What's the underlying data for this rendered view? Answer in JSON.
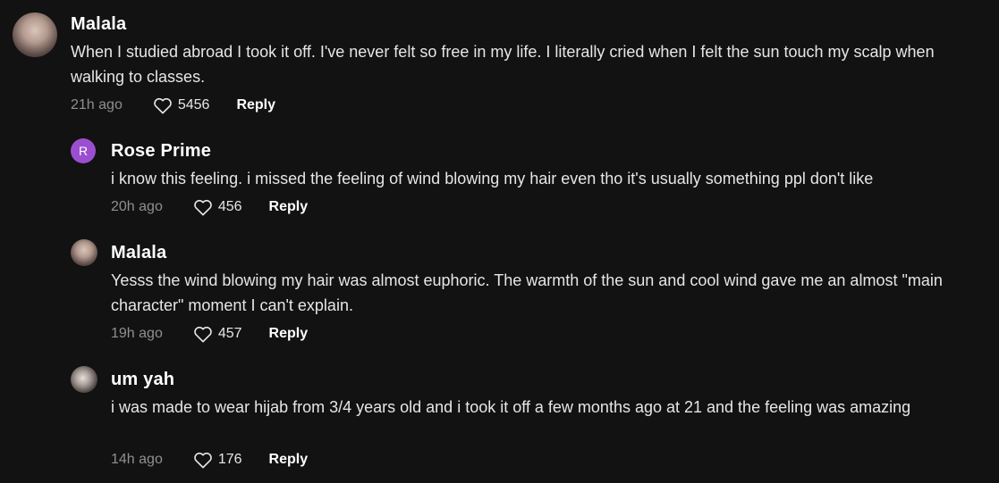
{
  "comments": [
    {
      "author": "Malala",
      "avatar": {
        "type": "photo"
      },
      "text": "When I studied abroad I took it off. I've never felt so free in my life. I literally cried when I felt the sun touch my scalp when walking to classes.",
      "time": "21h ago",
      "likes": "5456",
      "reply_label": "Reply"
    },
    {
      "author": "Rose Prime",
      "avatar": {
        "type": "letter",
        "letter": "R",
        "color": "#9b4fd0"
      },
      "text": "i know this feeling. i missed the feeling of wind blowing my hair even tho it's usually something ppl don't like",
      "time": "20h ago",
      "likes": "456",
      "reply_label": "Reply"
    },
    {
      "author": "Malala",
      "avatar": {
        "type": "photo"
      },
      "text": "Yesss the wind blowing my hair was almost euphoric. The warmth of the sun and cool wind gave me an almost \"main character\" moment I can't explain.",
      "time": "19h ago",
      "likes": "457",
      "reply_label": "Reply"
    },
    {
      "author": "um yah",
      "avatar": {
        "type": "photo"
      },
      "text": "i was made to wear hijab from 3/4 years old and i took it off a few months ago at 21 and the feeling was amazing",
      "time": "14h ago",
      "likes": "176",
      "reply_label": "Reply"
    }
  ],
  "icons": {
    "like": "heart-outline-icon"
  }
}
